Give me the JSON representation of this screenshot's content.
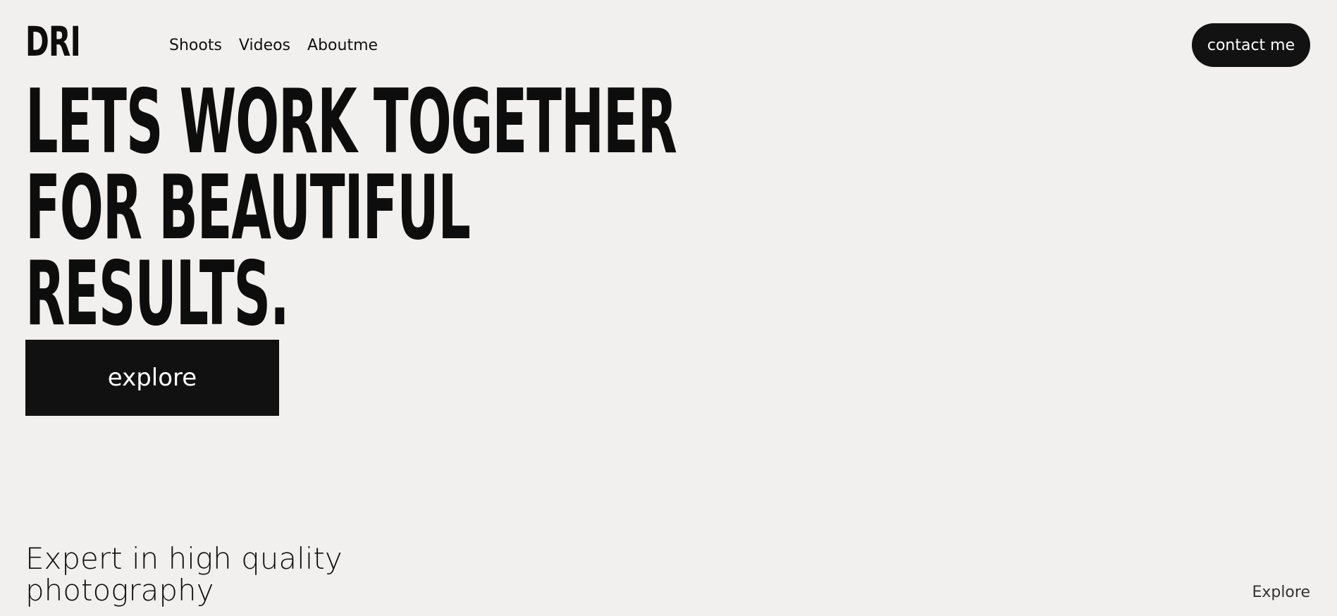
{
  "header": {
    "logo": "DRI",
    "nav": [
      {
        "label": "Shoots"
      },
      {
        "label": "Videos"
      },
      {
        "label": "Aboutme"
      }
    ],
    "contact_label": "contact me"
  },
  "hero": {
    "lines": [
      "LETS WORK TOGETHER",
      "FOR BEAUTIFUL",
      "RESULTS."
    ],
    "explore_label": "explore"
  },
  "footer": {
    "tagline_lines": [
      "Expert in high quality",
      "photography"
    ],
    "explore_link": "Explore"
  },
  "colors": {
    "background": "#f1f0ee",
    "text": "#0d0d0d",
    "button_bg": "#121212",
    "button_text": "#ffffff"
  }
}
